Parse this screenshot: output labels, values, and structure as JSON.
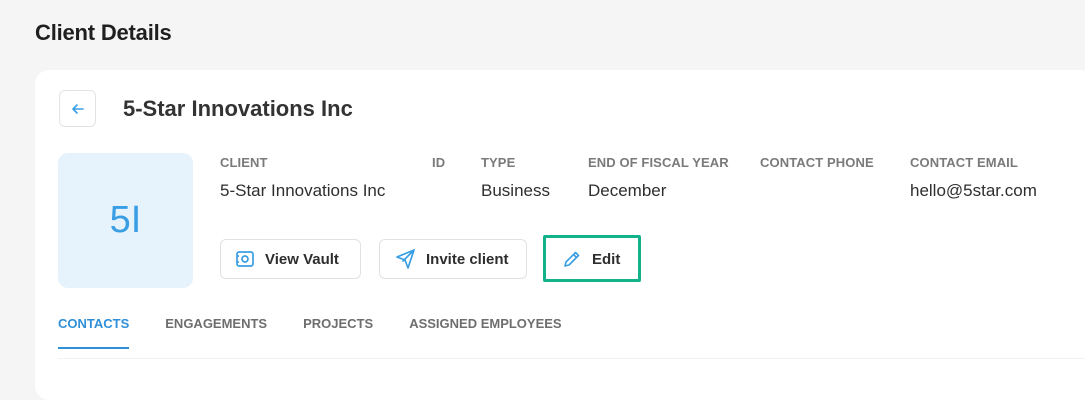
{
  "page": {
    "title": "Client Details"
  },
  "client": {
    "name": "5-Star Innovations Inc",
    "initials": "5I",
    "fields": {
      "client": {
        "label": "CLIENT",
        "value": "5-Star Innovations Inc"
      },
      "id": {
        "label": "ID",
        "value": ""
      },
      "type": {
        "label": "TYPE",
        "value": "Business"
      },
      "fiscal_year_end": {
        "label": "END OF FISCAL YEAR",
        "value": "December"
      },
      "contact_phone": {
        "label": "CONTACT PHONE",
        "value": ""
      },
      "contact_email": {
        "label": "CONTACT EMAIL",
        "value": "hello@5star.com"
      }
    }
  },
  "actions": {
    "view_vault": "View Vault",
    "invite_client": "Invite client",
    "edit": "Edit"
  },
  "tabs": [
    {
      "label": "CONTACTS",
      "active": true
    },
    {
      "label": "ENGAGEMENTS",
      "active": false
    },
    {
      "label": "PROJECTS",
      "active": false
    },
    {
      "label": "ASSIGNED EMPLOYEES",
      "active": false
    }
  ],
  "colors": {
    "accent": "#2f8fd8",
    "highlight": "#12b28b",
    "avatar_bg": "#e6f3fd",
    "avatar_text": "#3a9ee4"
  },
  "icons": {
    "back": "arrow-left-icon",
    "vault": "vault-icon",
    "invite": "send-icon",
    "edit": "pencil-icon"
  }
}
